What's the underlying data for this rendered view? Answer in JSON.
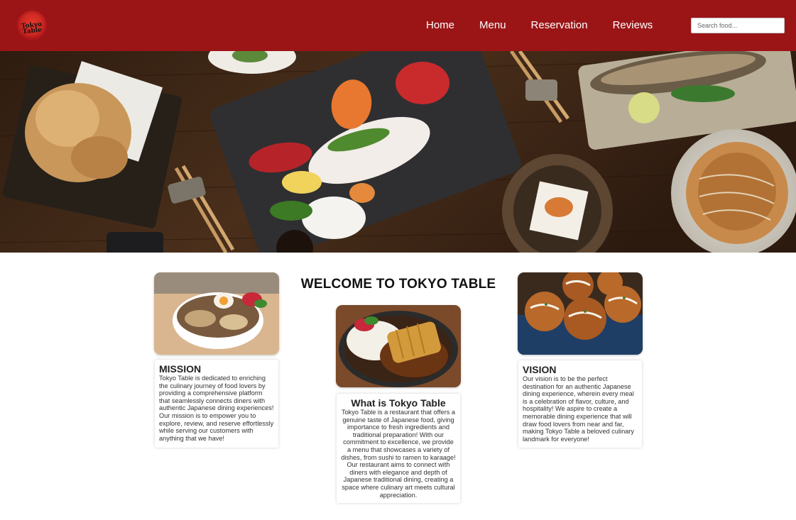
{
  "header": {
    "logo_text": "Tokyo Table",
    "nav": [
      "Home",
      "Menu",
      "Reservation",
      "Reviews"
    ],
    "search_placeholder": "Search food..."
  },
  "welcome_title": "WELCOME TO TOKYO TABLE",
  "mission": {
    "title": "MISSION",
    "body": "Tokyo Table is dedicated to enriching the culinary journey of food lovers by providing a comprehensive platform that seamlessly connects diners with authentic Japanese dining experiences! Our mission is to empower you to explore, review, and reserve effortlessly while serving our customers with anything that we have!"
  },
  "about": {
    "title": "What is Tokyo Table",
    "body": "Tokyo Table is a restaurant that offers a genuine taste of Japanese food, giving importance to fresh ingredients and traditional preparation! With our commitment to excellence, we provide a menu that showcases a variety of dishes, from sushi to ramen to karaage! Our restaurant aims to connect with diners with elegance and depth of Japanese traditional dining, creating a space where culinary art meets cultural appreciation."
  },
  "vision": {
    "title": "VISION",
    "body": "Our vision is to be the perfect destination for an authentic Japanese dining experience, wherein every meal is a celebration of flavor, culture, and hospitality! We aspire to create a memorable dining experience that will draw food lovers from near and far, making Tokyo Table a beloved culinary landmark for everyone!"
  }
}
